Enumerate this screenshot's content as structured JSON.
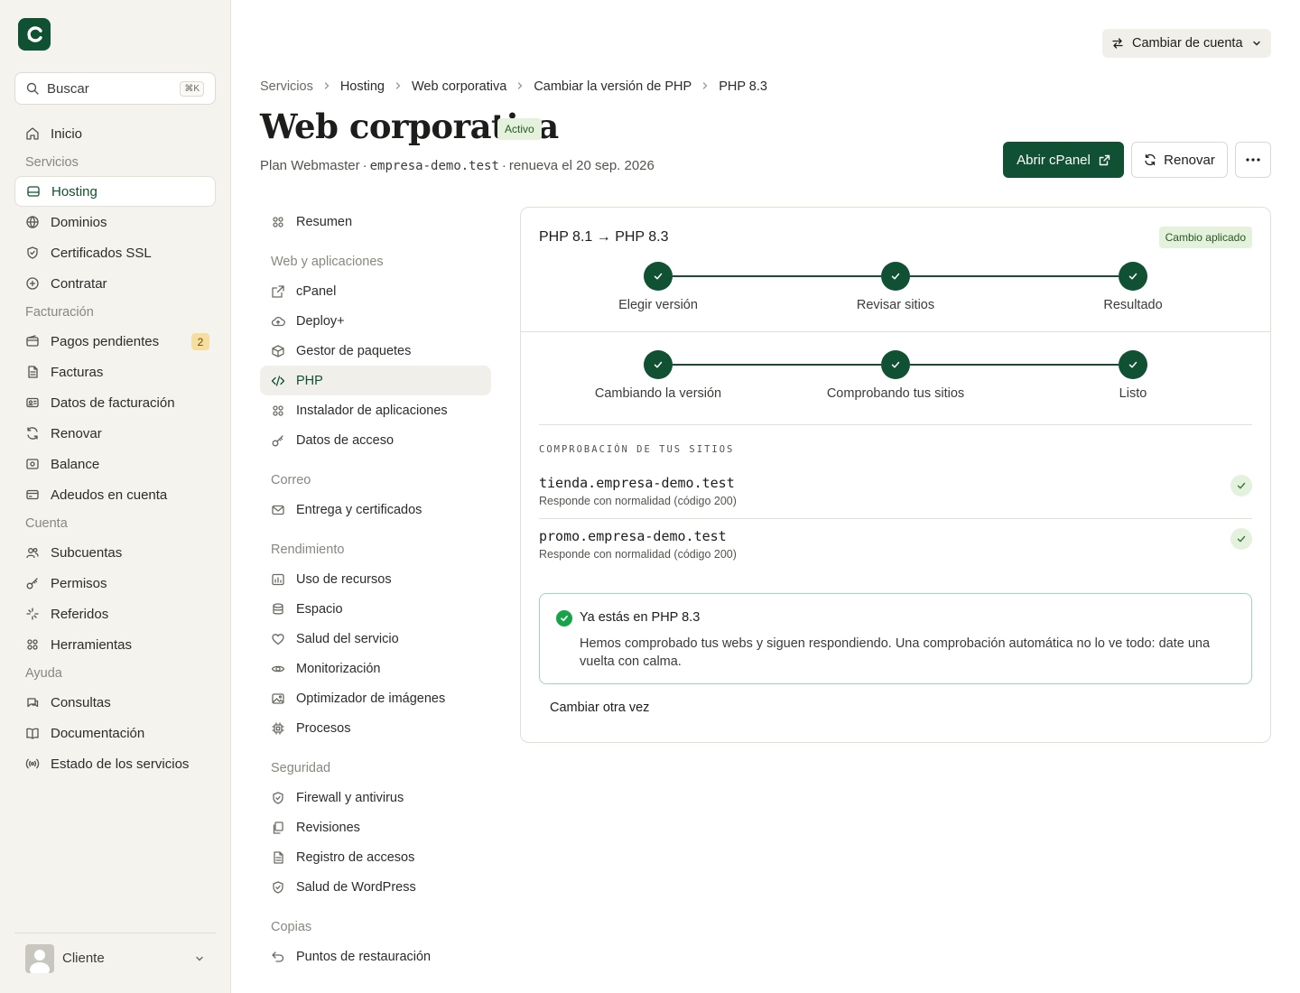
{
  "brand": {
    "logo_letter": "c",
    "accent": "#0f5132",
    "logo_dot": "#a8e06c"
  },
  "search": {
    "placeholder": "Buscar",
    "shortcut": "⌘K"
  },
  "sidebar": {
    "items": [
      {
        "type": "item",
        "label": "Inicio",
        "icon": "home-icon"
      },
      {
        "type": "section",
        "label": "Servicios"
      },
      {
        "type": "item",
        "label": "Hosting",
        "icon": "hosting-icon",
        "active": true
      },
      {
        "type": "item",
        "label": "Dominios",
        "icon": "globe-icon"
      },
      {
        "type": "item",
        "label": "Certificados SSL",
        "icon": "shield-icon"
      },
      {
        "type": "item",
        "label": "Contratar",
        "icon": "plus-circle-icon"
      },
      {
        "type": "section",
        "label": "Facturación"
      },
      {
        "type": "item",
        "label": "Pagos pendientes",
        "icon": "wallet-icon",
        "badge": "2"
      },
      {
        "type": "item",
        "label": "Facturas",
        "icon": "file-icon"
      },
      {
        "type": "item",
        "label": "Datos de facturación",
        "icon": "id-card-icon"
      },
      {
        "type": "item",
        "label": "Renovar",
        "icon": "refresh-icon"
      },
      {
        "type": "item",
        "label": "Balance",
        "icon": "cash-icon"
      },
      {
        "type": "item",
        "label": "Adeudos en cuenta",
        "icon": "credit-card-icon"
      },
      {
        "type": "section",
        "label": "Cuenta"
      },
      {
        "type": "item",
        "label": "Subcuentas",
        "icon": "users-icon"
      },
      {
        "type": "item",
        "label": "Permisos",
        "icon": "key-icon"
      },
      {
        "type": "item",
        "label": "Referidos",
        "icon": "sparkle-icon"
      },
      {
        "type": "item",
        "label": "Herramientas",
        "icon": "grid-icon"
      },
      {
        "type": "section",
        "label": "Ayuda"
      },
      {
        "type": "item",
        "label": "Consultas",
        "icon": "chat-icon"
      },
      {
        "type": "item",
        "label": "Documentación",
        "icon": "book-icon"
      },
      {
        "type": "item",
        "label": "Estado de los servicios",
        "icon": "broadcast-icon"
      }
    ],
    "user": {
      "name": "Cliente"
    }
  },
  "header": {
    "account_switch": "Cambiar de cuenta",
    "breadcrumb": [
      "Servicios",
      "Hosting",
      "Web corporativa",
      "Cambiar la versión de PHP",
      "PHP 8.3"
    ],
    "title": "Web corporativa",
    "status": "Activo",
    "plan": "Plan Webmaster",
    "domain": "empresa-demo.test",
    "renewal": "renueva el 20 sep. 2026",
    "open_cpanel": "Abrir cPanel",
    "renew": "Renovar"
  },
  "subnav": [
    {
      "type": "item",
      "label": "Resumen",
      "icon": "grid-icon"
    },
    {
      "type": "section",
      "label": "Web y aplicaciones"
    },
    {
      "type": "item",
      "label": "cPanel",
      "icon": "external-link-icon"
    },
    {
      "type": "item",
      "label": "Deploy+",
      "icon": "cloud-upload-icon"
    },
    {
      "type": "item",
      "label": "Gestor de paquetes",
      "icon": "package-icon"
    },
    {
      "type": "item",
      "label": "PHP",
      "icon": "code-icon",
      "active": true
    },
    {
      "type": "item",
      "label": "Instalador de aplicaciones",
      "icon": "grid-icon"
    },
    {
      "type": "item",
      "label": "Datos de acceso",
      "icon": "key-icon"
    },
    {
      "type": "section",
      "label": "Correo"
    },
    {
      "type": "item",
      "label": "Entrega y certificados",
      "icon": "mail-icon"
    },
    {
      "type": "section",
      "label": "Rendimiento"
    },
    {
      "type": "item",
      "label": "Uso de recursos",
      "icon": "chart-icon"
    },
    {
      "type": "item",
      "label": "Espacio",
      "icon": "database-icon"
    },
    {
      "type": "item",
      "label": "Salud del servicio",
      "icon": "heart-icon"
    },
    {
      "type": "item",
      "label": "Monitorización",
      "icon": "eye-icon"
    },
    {
      "type": "item",
      "label": "Optimizador de imágenes",
      "icon": "image-icon"
    },
    {
      "type": "item",
      "label": "Procesos",
      "icon": "cpu-icon"
    },
    {
      "type": "section",
      "label": "Seguridad"
    },
    {
      "type": "item",
      "label": "Firewall y antivirus",
      "icon": "shield-icon"
    },
    {
      "type": "item",
      "label": "Revisiones",
      "icon": "copy-icon"
    },
    {
      "type": "item",
      "label": "Registro de accesos",
      "icon": "file-icon"
    },
    {
      "type": "item",
      "label": "Salud de WordPress",
      "icon": "shield-icon"
    },
    {
      "type": "section",
      "label": "Copias"
    },
    {
      "type": "item",
      "label": "Puntos de restauración",
      "icon": "undo-icon"
    }
  ],
  "card": {
    "title": "PHP 8.1 → PHP 8.3",
    "badge": "Cambio aplicado",
    "steps_top": [
      "Elegir versión",
      "Revisar sitios",
      "Resultado"
    ],
    "steps_progress": [
      "Cambiando la versión",
      "Comprobando tus sitios",
      "Listo"
    ],
    "checks_heading": "COMPROBACIÓN DE TUS SITIOS",
    "sites": [
      {
        "name": "tienda.empresa-demo.test",
        "status": "Responde con normalidad (código 200)"
      },
      {
        "name": "promo.empresa-demo.test",
        "status": "Responde con normalidad (código 200)"
      }
    ],
    "success_title": "Ya estás en PHP 8.3",
    "success_text": "Hemos comprobado tus webs y siguen respondiendo. Una comprobación automática no lo ve todo: date una vuelta con calma.",
    "change_again": "Cambiar otra vez"
  }
}
